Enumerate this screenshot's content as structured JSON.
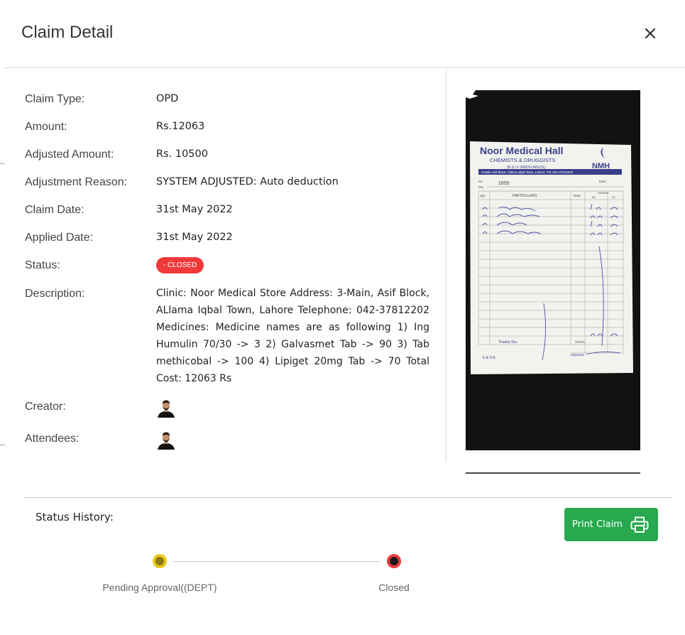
{
  "modal": {
    "title": "Claim Detail"
  },
  "fields": {
    "claim_type": {
      "label": "Claim Type:",
      "value": "OPD"
    },
    "amount": {
      "label": "Amount:",
      "value": "Rs.12063"
    },
    "adjusted_amount": {
      "label": "Adjusted Amount:",
      "value": "Rs. 10500"
    },
    "adjustment_reason": {
      "label": "Adjustment Reason:",
      "value": "SYSTEM ADJUSTED: Auto deduction"
    },
    "claim_date": {
      "label": "Claim Date:",
      "value": "31st May 2022"
    },
    "applied_date": {
      "label": "Applied Date:",
      "value": "31st May 2022"
    },
    "status": {
      "label": "Status:",
      "value": "- CLOSED"
    },
    "description": {
      "label": "Description:",
      "value": "Clinic: Noor Medical Store Address: 3-Main, Asif Block, ALlama Iqbal Town, Lahore Telephone: 042-37812202 Medicines: Medicine names are as following 1) Ing Humulin 70/30 -> 3 2) Galvasmet Tab -> 90 3) Tab methicobal -> 100 4) Lipiget 20mg Tab -> 70 Total Cost: 12063 Rs"
    },
    "creator": {
      "label": "Creator:"
    },
    "attendees": {
      "label": "Attendees:"
    }
  },
  "receipt": {
    "store_name": "Noor Medical Hall",
    "subtitle": "CHEMISTS & DRUGGISTS",
    "license": "(R.S.I.# 3492/9-3491/11)",
    "logo": "NMH",
    "address": "3-Main Asif Block, Allama Iqbal Town, Lahore. Tel: 042-37812202",
    "no_label": "No.",
    "number": "1655",
    "date_label": "Date:",
    "ms_label": "M/s.",
    "col_qty": "Qty.",
    "col_particulars": "PARTICULARS",
    "col_rate": "Rate",
    "col_amount": "Amount",
    "col_rs": "Rs",
    "col_ps": "Ps",
    "footer_thanks": "Thanks You",
    "footer_total": "TOTAL",
    "footer_eoe": "E.& O.E",
    "footer_signature": "Signature"
  },
  "history": {
    "title": "Status History:",
    "steps": [
      {
        "label": "Pending Approval((DEPT)",
        "color": "#e8c81a"
      },
      {
        "label": "Closed",
        "color": "#f03a3a"
      }
    ]
  },
  "print_button": {
    "label": "Print Claim"
  },
  "colors": {
    "badge_red": "#f03a3a",
    "print_green": "#28a94f",
    "pending_yellow": "#e8c81a"
  }
}
